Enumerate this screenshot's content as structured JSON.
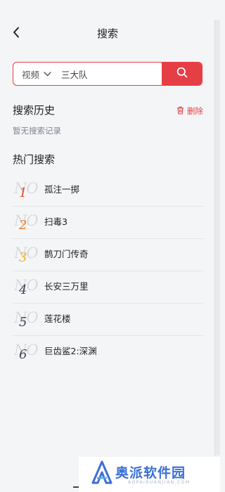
{
  "header": {
    "title": "搜索",
    "back_icon": "chevron-left-icon"
  },
  "search": {
    "type_label": "视频",
    "query": "三大队",
    "button_icon": "search-icon",
    "accent_color": "#e53e45"
  },
  "history": {
    "title": "搜索历史",
    "delete_label": "删除",
    "empty_text": "暂无搜索记录"
  },
  "hot": {
    "title": "热门搜索",
    "badge_text": "NO",
    "items": [
      {
        "rank": "1",
        "name": "孤注一掷",
        "color": "#e94b35"
      },
      {
        "rank": "2",
        "name": "扫毒3",
        "color": "#f07a1e"
      },
      {
        "rank": "3",
        "name": "鹊刀门传奇",
        "color": "#f5b219"
      },
      {
        "rank": "4",
        "name": "长安三万里",
        "color": "#3c4656"
      },
      {
        "rank": "5",
        "name": "莲花楼",
        "color": "#3c4656"
      },
      {
        "rank": "6",
        "name": "巨齿鲨2:深渊",
        "color": "#3c4656"
      }
    ]
  },
  "watermark": {
    "text": "奥派软件园",
    "sub": "AOPAIRUANJIAN.COM",
    "color": "#3b6fd6"
  }
}
